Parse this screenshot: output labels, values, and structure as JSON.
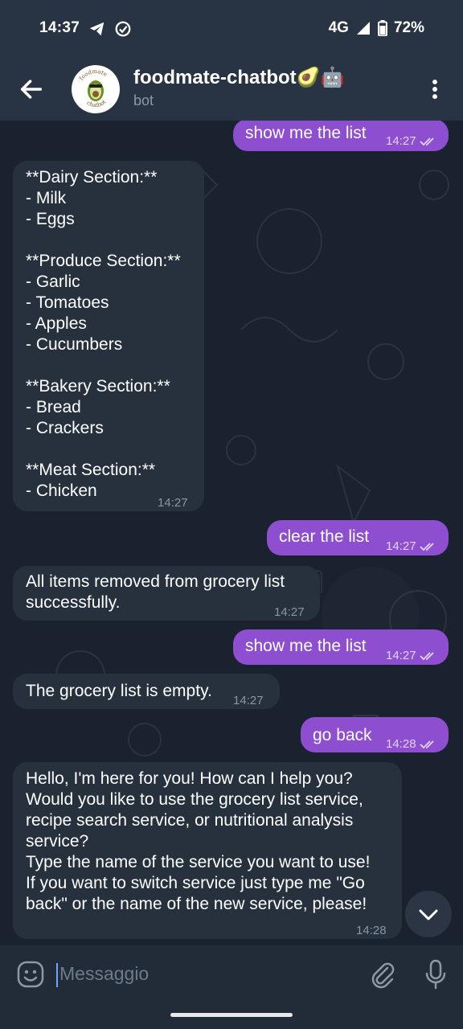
{
  "status_bar": {
    "time": "14:37",
    "network": "4G",
    "battery": "72%"
  },
  "header": {
    "title": "foodmate-chatbot🥑🤖",
    "subtitle": "bot",
    "avatar_text_top": "foodmate",
    "avatar_text_bottom": "chatbot"
  },
  "messages": [
    {
      "dir": "out",
      "text": "show me the list",
      "time": "14:27"
    },
    {
      "dir": "in",
      "text": "**Dairy Section:**\n- Milk\n- Eggs\n\n**Produce Section:**\n- Garlic\n- Tomatoes\n- Apples\n- Cucumbers\n\n**Bakery Section:**\n- Bread\n- Crackers\n\n**Meat Section:**\n- Chicken",
      "time": "14:27"
    },
    {
      "dir": "out",
      "text": "clear the list",
      "time": "14:27"
    },
    {
      "dir": "in",
      "text": "All items removed from grocery list\nsuccessfully.",
      "time": "14:27"
    },
    {
      "dir": "out",
      "text": "show me the list",
      "time": "14:27"
    },
    {
      "dir": "in",
      "text": "The grocery list is empty.",
      "time": "14:27"
    },
    {
      "dir": "out",
      "text": "go back",
      "time": "14:28"
    },
    {
      "dir": "in",
      "text": "Hello, I'm here for you! How can I help you?\nWould you like to use the grocery list service,\nrecipe search service, or nutritional analysis\nservice?\nType the name of the service you want to use!\nIf you want to switch service just type me \"Go\nback\" or the name of the new service, please!",
      "time": "14:28"
    }
  ],
  "input": {
    "placeholder": "Messaggio"
  },
  "icons": {
    "back": "arrow-left-icon",
    "menu": "more-vertical-icon",
    "emoji": "emoji-icon",
    "attach": "paperclip-icon",
    "mic": "microphone-icon",
    "scroll_down": "chevron-down-icon",
    "read": "double-check-icon"
  },
  "colors": {
    "outgoing_bubble": "#8d4fd0",
    "incoming_bubble": "#27313e",
    "header": "#283443",
    "background": "#1a2230"
  }
}
